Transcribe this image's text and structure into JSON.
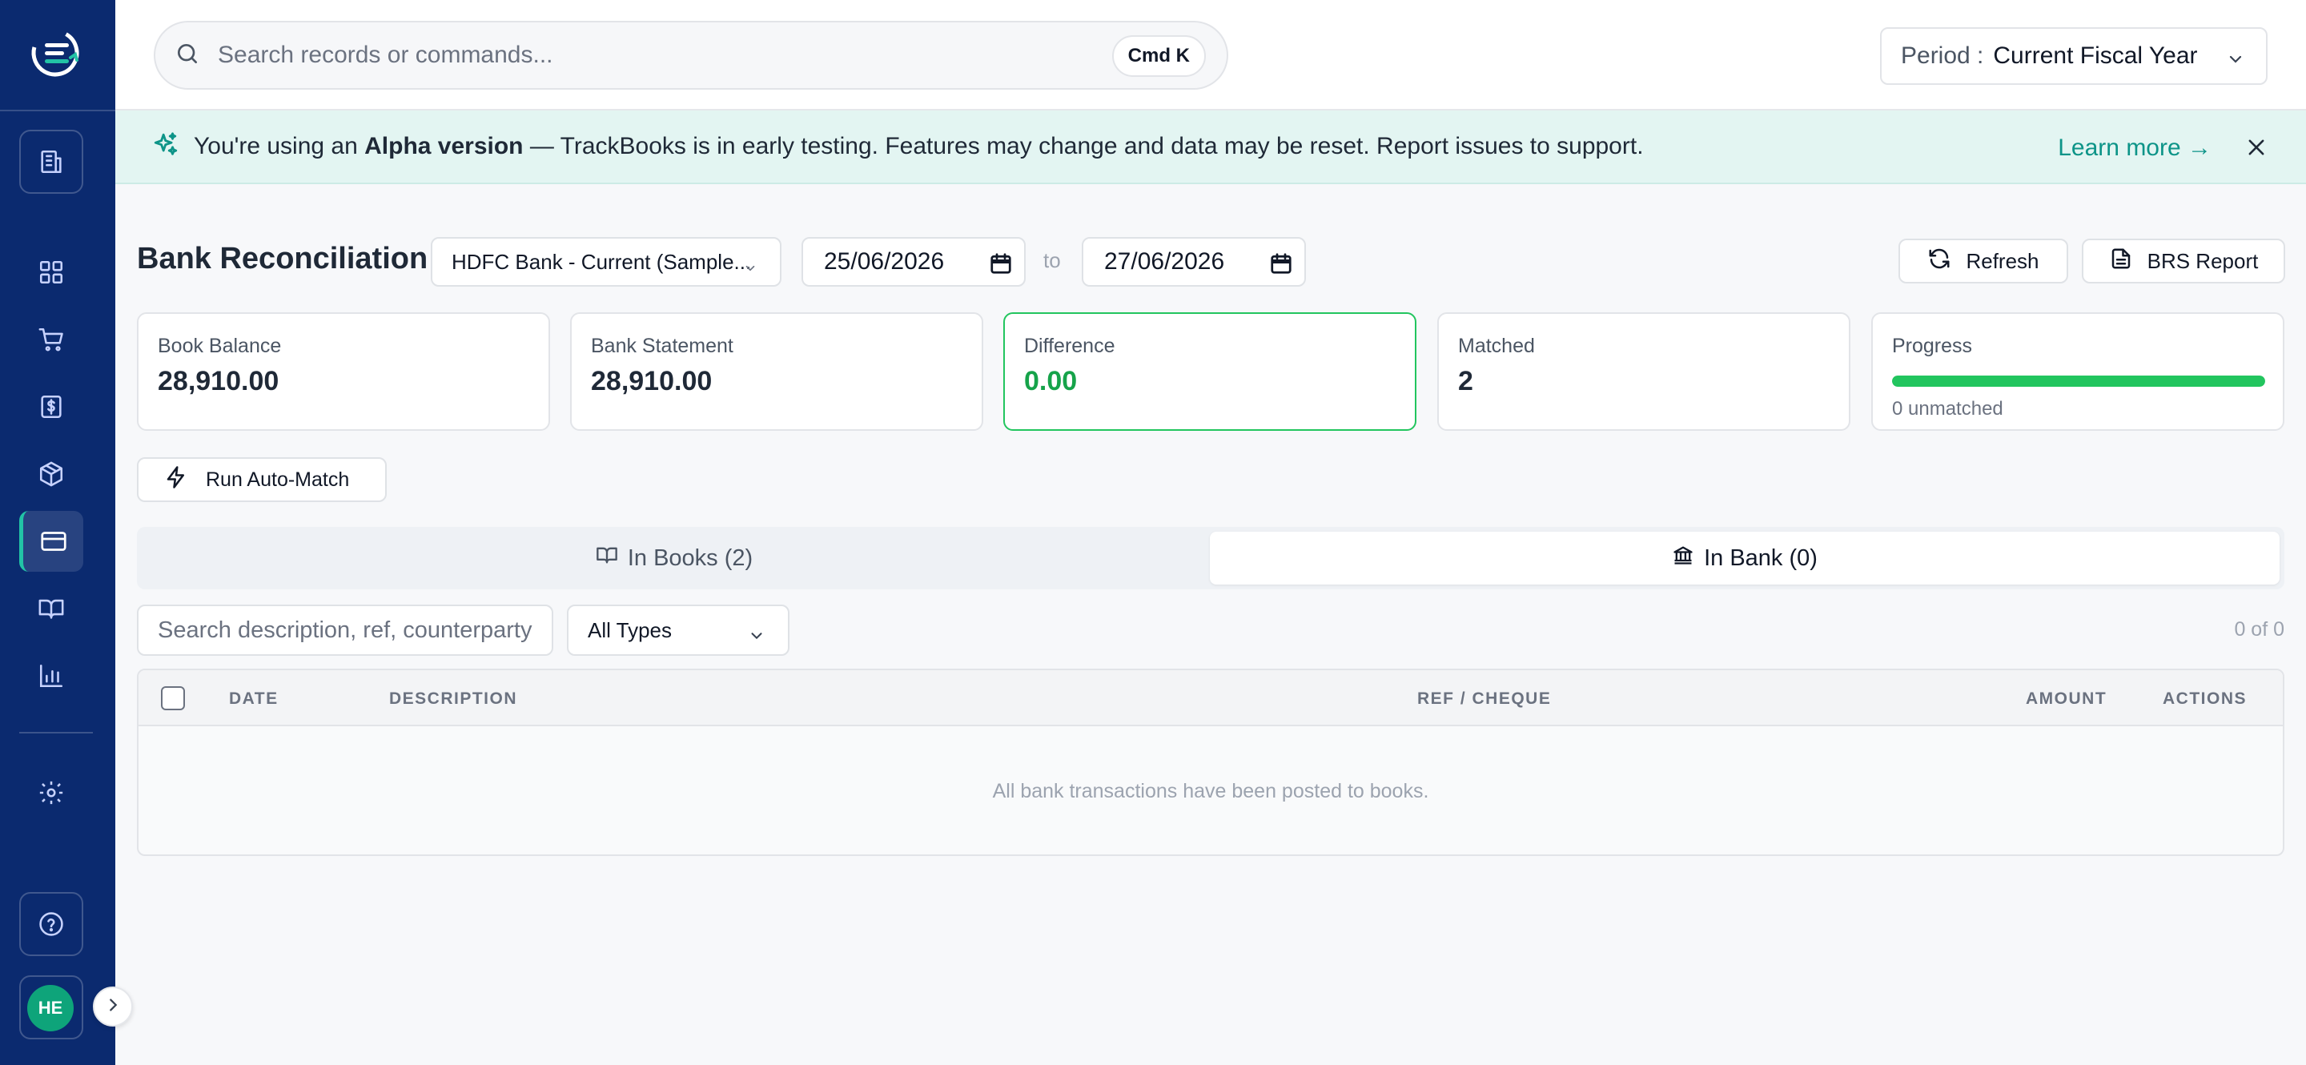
{
  "search": {
    "placeholder": "Search records or commands...",
    "shortcut": "Cmd K"
  },
  "period": {
    "label": "Period :",
    "value": "Current Fiscal Year"
  },
  "banner": {
    "prefix": "You're using an ",
    "highlight": "Alpha version",
    "suffix": " — TrackBooks is in early testing. Features may change and data may be reset. Report issues to support.",
    "link": "Learn more →"
  },
  "page": {
    "title": "Bank Reconciliation",
    "bank_account": "HDFC Bank - Current (Sample...",
    "date_from": "25/06/2026",
    "to_label": "to",
    "date_to": "27/06/2026",
    "refresh_label": "Refresh",
    "brs_label": "BRS Report"
  },
  "stats": {
    "book_balance": {
      "label": "Book Balance",
      "value": "28,910.00"
    },
    "bank_statement": {
      "label": "Bank Statement",
      "value": "28,910.00"
    },
    "difference": {
      "label": "Difference",
      "value": "0.00"
    },
    "matched": {
      "label": "Matched",
      "value": "2"
    },
    "progress": {
      "label": "Progress",
      "fraction": 1.0,
      "sub": "0 unmatched"
    }
  },
  "automatch_label": "Run Auto-Match",
  "tabs": [
    {
      "label": "In Books (2)"
    },
    {
      "label": "In Bank (0)"
    }
  ],
  "filters": {
    "search_placeholder": "Search description, ref, counterparty",
    "type_value": "All Types",
    "count": "0 of 0"
  },
  "table": {
    "columns": [
      "DATE",
      "DESCRIPTION",
      "REF / CHEQUE",
      "AMOUNT",
      "ACTIONS"
    ],
    "empty_message": "All bank transactions have been posted to books."
  },
  "user": {
    "initials": "HE"
  },
  "colors": {
    "sidebar": "#0b2a6f",
    "accent": "#0d9488",
    "success": "#16a34a"
  }
}
